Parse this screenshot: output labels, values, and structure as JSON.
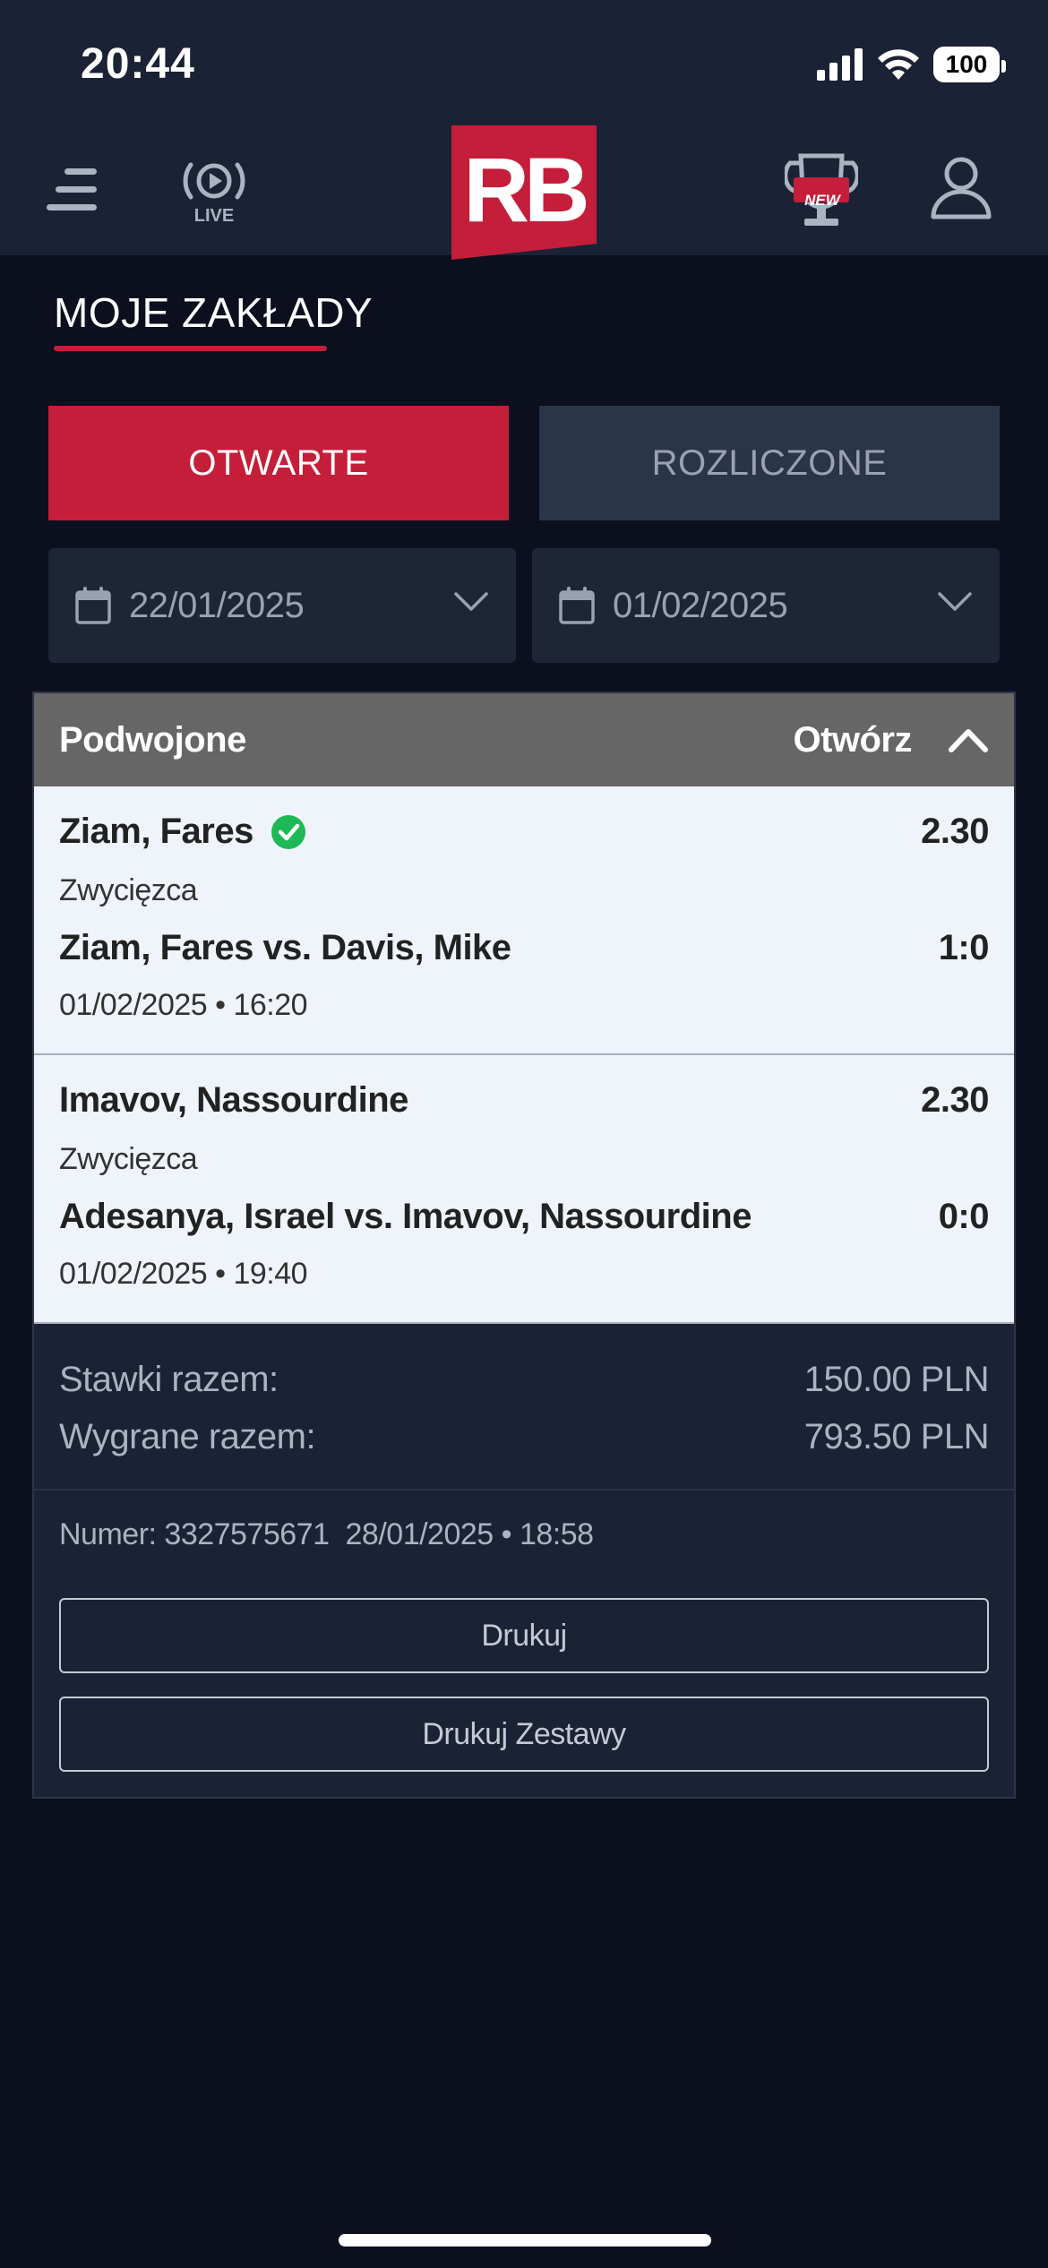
{
  "status_bar": {
    "time": "20:44",
    "battery": "100"
  },
  "header": {
    "live_label": "LIVE",
    "logo_text": "RB",
    "trophy_badge": "NEW"
  },
  "page": {
    "title": "MOJE ZAKŁADY"
  },
  "tabs": [
    {
      "label": "OTWARTE",
      "active": true
    },
    {
      "label": "ROZLICZONE",
      "active": false
    }
  ],
  "date_range": {
    "from": "22/01/2025",
    "to": "01/02/2025"
  },
  "bet": {
    "type": "Podwojone",
    "toggle_label": "Otwórz",
    "selections": [
      {
        "pick": "Ziam, Fares",
        "won": true,
        "odds": "2.30",
        "market": "Zwycięzca",
        "match": "Ziam, Fares vs. Davis, Mike",
        "score": "1:0",
        "datetime": "01/02/2025 • 16:20"
      },
      {
        "pick": "Imavov, Nassourdine",
        "won": false,
        "odds": "2.30",
        "market": "Zwycięzca",
        "match": "Adesanya, Israel vs. Imavov, Nassourdine",
        "score": "0:0",
        "datetime": "01/02/2025 • 19:40"
      }
    ],
    "totals": {
      "stake_label": "Stawki razem:",
      "stake_value": "150.00 PLN",
      "win_label": "Wygrane razem:",
      "win_value": "793.50 PLN"
    },
    "meta": {
      "number": "Numer: 3327575671",
      "placed_at": "28/01/2025 • 18:58"
    },
    "print_label": "Drukuj",
    "print_sets_label": "Drukuj Zestawy"
  },
  "colors": {
    "accent": "#c41e3a",
    "background": "#0b0f1e",
    "header": "#1b2235",
    "success": "#1db954"
  }
}
